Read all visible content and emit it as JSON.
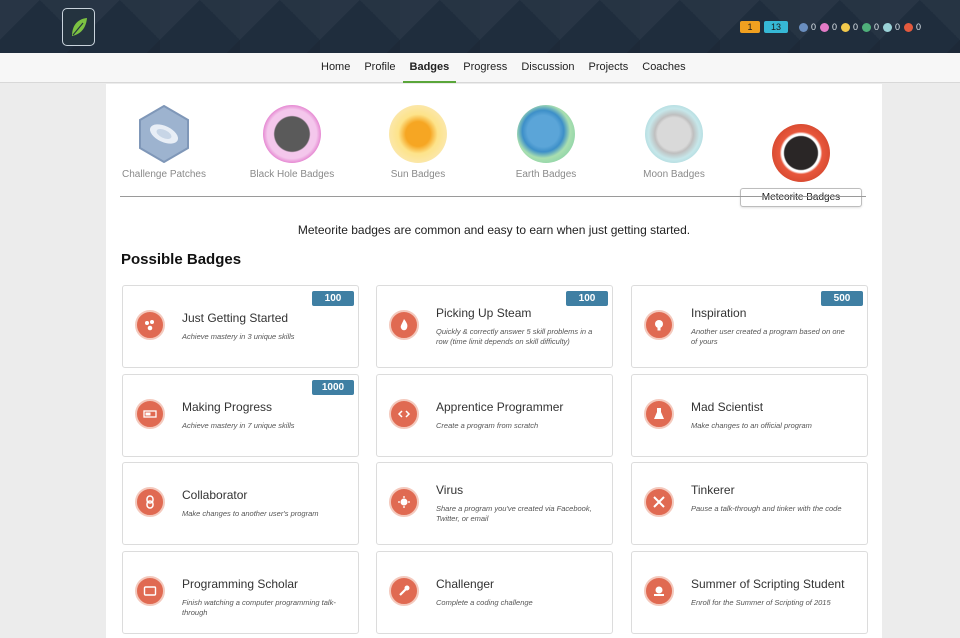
{
  "header": {
    "pills": [
      "1",
      "13"
    ],
    "mini_counts": [
      "0",
      "0",
      "0",
      "0",
      "0",
      "0"
    ],
    "colors": {
      "bg": "#1f2d3d",
      "accent_green": "#5aa63a"
    }
  },
  "nav": {
    "items": [
      "Home",
      "Profile",
      "Badges",
      "Progress",
      "Discussion",
      "Projects",
      "Coaches"
    ],
    "active": "Badges"
  },
  "badge_types": [
    {
      "label": "Challenge Patches"
    },
    {
      "label": "Black Hole Badges"
    },
    {
      "label": "Sun Badges"
    },
    {
      "label": "Earth Badges"
    },
    {
      "label": "Moon Badges"
    },
    {
      "label": "Meteorite Badges"
    }
  ],
  "description": "Meteorite badges are common and easy to earn when just getting started.",
  "heading": "Possible Badges",
  "badges": [
    {
      "title": "Just Getting Started",
      "sub": "Achieve mastery in 3 unique skills",
      "points": "100",
      "icon": "meteor-chunks-icon"
    },
    {
      "title": "Picking Up Steam",
      "sub": "Quickly & correctly answer 5 skill problems in a row (time limit depends on skill difficulty)",
      "points": "100",
      "icon": "flame-icon"
    },
    {
      "title": "Inspiration",
      "sub": "Another user created a program based on one of yours",
      "points": "500",
      "icon": "lightbulb-icon"
    },
    {
      "title": "Making Progress",
      "sub": "Achieve mastery in 7 unique skills",
      "points": "1000",
      "icon": "progress-bar-icon"
    },
    {
      "title": "Apprentice Programmer",
      "sub": "Create a program from scratch",
      "points": "",
      "icon": "code-icon"
    },
    {
      "title": "Mad Scientist",
      "sub": "Make changes to an official program",
      "points": "",
      "icon": "flask-icon"
    },
    {
      "title": "Collaborator",
      "sub": "Make changes to another user's program",
      "points": "",
      "icon": "link-icon"
    },
    {
      "title": "Virus",
      "sub": "Share a program you've created via Facebook, Twitter, or email",
      "points": "",
      "icon": "virus-icon"
    },
    {
      "title": "Tinkerer",
      "sub": "Pause a talk-through and tinker with the code",
      "points": "",
      "icon": "tools-icon"
    },
    {
      "title": "Programming Scholar",
      "sub": "Finish watching a computer programming talk-through",
      "points": "",
      "icon": "screen-icon"
    },
    {
      "title": "Challenger",
      "sub": "Complete a coding challenge",
      "points": "",
      "icon": "wrench-icon"
    },
    {
      "title": "Summer of Scripting Student",
      "sub": "Enroll for the Summer of Scripting of 2015",
      "points": "",
      "icon": "summer-badge-icon"
    }
  ]
}
